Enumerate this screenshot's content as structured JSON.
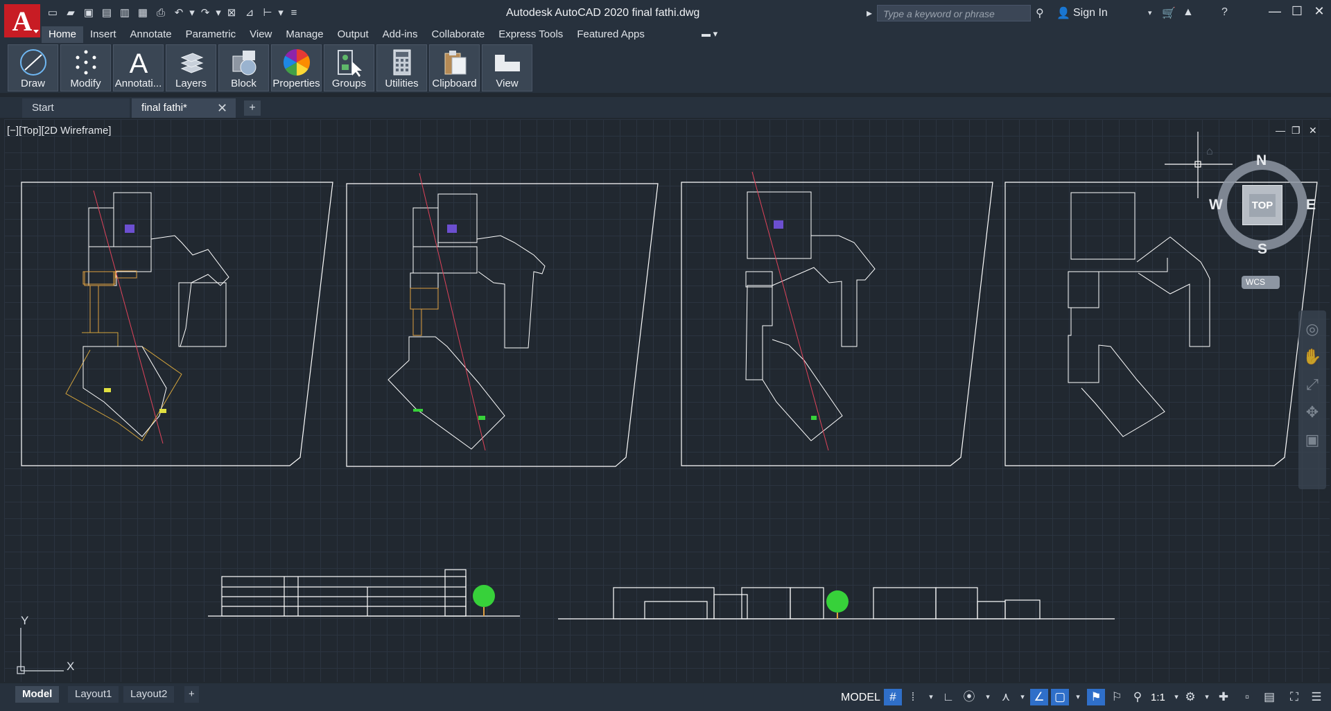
{
  "app": {
    "title": "Autodesk AutoCAD 2020    final fathi.dwg",
    "logo_letter": "A",
    "search_placeholder": "Type a keyword or phrase",
    "signin_label": "Sign In"
  },
  "menu": {
    "tabs": [
      "Home",
      "Insert",
      "Annotate",
      "Parametric",
      "View",
      "Manage",
      "Output",
      "Add-ins",
      "Collaborate",
      "Express Tools",
      "Featured Apps"
    ]
  },
  "ribbon": {
    "buttons": [
      {
        "label": "Draw",
        "icon": "draw-icon"
      },
      {
        "label": "Modify",
        "icon": "modify-icon"
      },
      {
        "label": "Annotati...",
        "icon": "annotation-icon"
      },
      {
        "label": "Layers",
        "icon": "layers-icon"
      },
      {
        "label": "Block",
        "icon": "block-icon"
      },
      {
        "label": "Properties",
        "icon": "properties-icon"
      },
      {
        "label": "Groups",
        "icon": "groups-icon"
      },
      {
        "label": "Utilities",
        "icon": "utilities-icon"
      },
      {
        "label": "Clipboard",
        "icon": "clipboard-icon"
      },
      {
        "label": "View",
        "icon": "view-icon"
      }
    ]
  },
  "file_tabs": {
    "start": "Start",
    "file": "final fathi*",
    "close": "✕",
    "add": "+"
  },
  "viewport": {
    "label": "[−][Top][2D Wireframe]",
    "viewcube": {
      "top": "TOP",
      "n": "N",
      "s": "S",
      "e": "E",
      "w": "W",
      "wcs": "WCS"
    },
    "ucs": {
      "x": "X",
      "y": "Y"
    }
  },
  "status": {
    "layout_tabs": [
      "Model",
      "Layout1",
      "Layout2"
    ],
    "layout_add": "+",
    "model_label": "MODEL",
    "scale": "1:1"
  },
  "colors": {
    "accent": "#2f6fc9",
    "logo": "#c81c24",
    "background": "#212830"
  }
}
